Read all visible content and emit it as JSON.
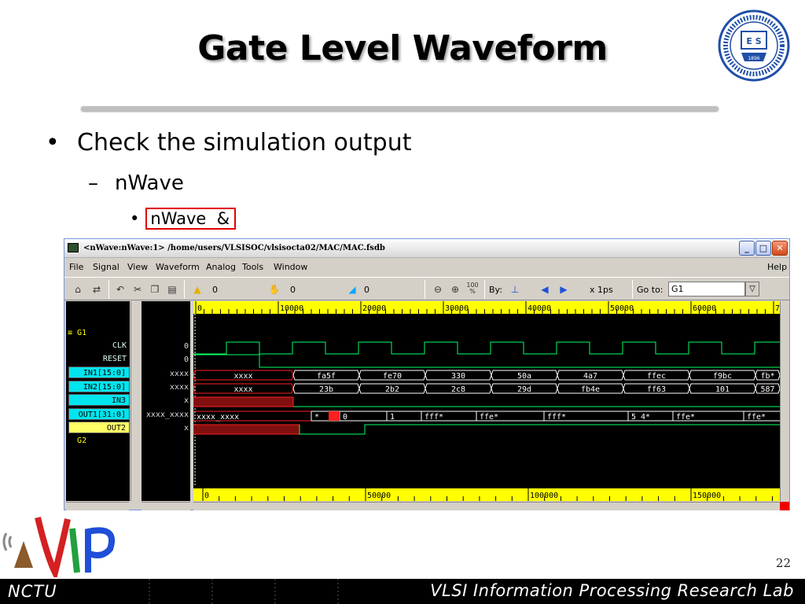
{
  "slide": {
    "title": "Gate Level Waveform",
    "bullet1": "Check the simulation output",
    "bullet2": "nWave",
    "bullet3_command": "nWave  &",
    "page_number": "22",
    "footer_left": "NCTU",
    "footer_right": "VLSI Information Processing Research Lab",
    "seal_year": "1896"
  },
  "window": {
    "title": "<nWave:nWave:1> /home/users/VLSISOC/vlsisocta02/MAC/MAC.fsdb",
    "controls": [
      "minimize-icon",
      "maximize-icon",
      "close-icon"
    ]
  },
  "menu": {
    "items": [
      "File",
      "Signal",
      "View",
      "Waveform",
      "Analog",
      "Tools",
      "Window"
    ],
    "help": "Help"
  },
  "toolbar": {
    "cursor_value": "0",
    "marker_value": "0",
    "delta_value": "0",
    "zoom_fit_label": "100\n%",
    "by_label": "By:",
    "time_unit": "x 1ps",
    "goto_label": "Go to:",
    "goto_value": "G1"
  },
  "signals": {
    "group1": "G1",
    "group2": "G2",
    "names": [
      "CLK",
      "RESET",
      "IN1[15:0]",
      "IN2[15:0]",
      "IN3",
      "OUT1[31:0]",
      "OUT2"
    ],
    "values": [
      "0",
      "0",
      "xxxx",
      "xxxx",
      "x",
      "xxxx_xxxx",
      "x"
    ]
  },
  "waveform": {
    "top_ruler": [
      "0",
      "10000",
      "20000",
      "30000",
      "40000",
      "50000",
      "60000",
      "7"
    ],
    "bottom_ruler": [
      "0",
      "50000",
      "100000",
      "150000"
    ],
    "in1_values": [
      "xxxx",
      "fa5f",
      "fe70",
      "330",
      "50a",
      "4a7",
      "ffec",
      "f9bc",
      "fb*"
    ],
    "in2_values": [
      "xxxx",
      "23b",
      "2b2",
      "2c8",
      "29d",
      "fb4e",
      "ff63",
      "101",
      "587"
    ],
    "out1_values": [
      "xxxx_xxxx",
      "*",
      "0",
      "1",
      "fff*",
      "ffe*",
      "fff*",
      "5_4*",
      "ffe*",
      "ffe*"
    ],
    "colors": {
      "wave": "#00ff66",
      "bus": "#ffffff",
      "unknown": "#ff2020",
      "highlight": "#00e5ee"
    }
  }
}
